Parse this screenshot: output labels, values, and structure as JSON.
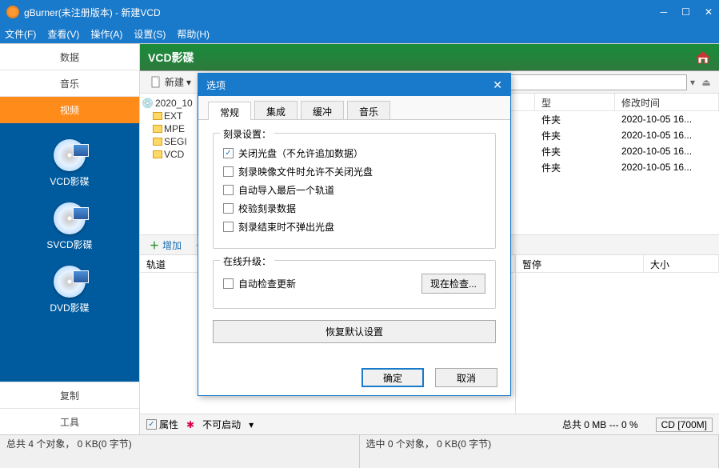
{
  "titlebar": {
    "title": "gBurner(未注册版本) - 新建VCD"
  },
  "menubar": {
    "items": [
      "文件(F)",
      "查看(V)",
      "操作(A)",
      "设置(S)",
      "帮助(H)"
    ]
  },
  "left": {
    "tabs": {
      "data": "数据",
      "music": "音乐",
      "video": "视频"
    },
    "discs": [
      {
        "label": "VCD影碟"
      },
      {
        "label": "SVCD影碟"
      },
      {
        "label": "DVD影碟"
      }
    ],
    "bottom": {
      "copy": "复制",
      "tool": "工具"
    }
  },
  "banner": {
    "title": "VCD影碟"
  },
  "toolbar": {
    "new": "新建"
  },
  "tree": {
    "root": "2020_10",
    "children": [
      "EXT",
      "MPE",
      "SEGI",
      "VCD"
    ]
  },
  "grid": {
    "headers": {
      "type": "型",
      "modified": "修改时间"
    },
    "rows": [
      {
        "type": "件夹",
        "modified": "2020-10-05 16..."
      },
      {
        "type": "件夹",
        "modified": "2020-10-05 16..."
      },
      {
        "type": "件夹",
        "modified": "2020-10-05 16..."
      },
      {
        "type": "件夹",
        "modified": "2020-10-05 16..."
      }
    ]
  },
  "mid": {
    "add": "增加",
    "remove": "---"
  },
  "lower": {
    "left_header": "轨道",
    "right_headers": {
      "pause": "暂停",
      "size": "大小"
    }
  },
  "bottom": {
    "props": "属性",
    "noboot": "不可启动",
    "total": "总共 0 MB --- 0 %",
    "cd": "CD [700M]"
  },
  "statusbar": {
    "left": "总共 4 个对象， 0 KB(0 字节)",
    "right": "选中 0 个对象， 0 KB(0 字节)"
  },
  "modal": {
    "title": "选项",
    "tabs": [
      "常规",
      "集成",
      "缓冲",
      "音乐"
    ],
    "group1": {
      "legend": "刻录设置：",
      "opts": [
        {
          "checked": true,
          "label": "关闭光盘（不允许追加数据）"
        },
        {
          "checked": false,
          "label": "刻录映像文件时允许不关闭光盘"
        },
        {
          "checked": false,
          "label": "自动导入最后一个轨道"
        },
        {
          "checked": false,
          "label": "校验刻录数据"
        },
        {
          "checked": false,
          "label": "刻录结束时不弹出光盘"
        }
      ]
    },
    "group2": {
      "legend": "在线升级：",
      "opt": {
        "checked": false,
        "label": "自动检查更新"
      },
      "check_now": "现在检查..."
    },
    "restore": "恢复默认设置",
    "ok": "确定",
    "cancel": "取消"
  }
}
